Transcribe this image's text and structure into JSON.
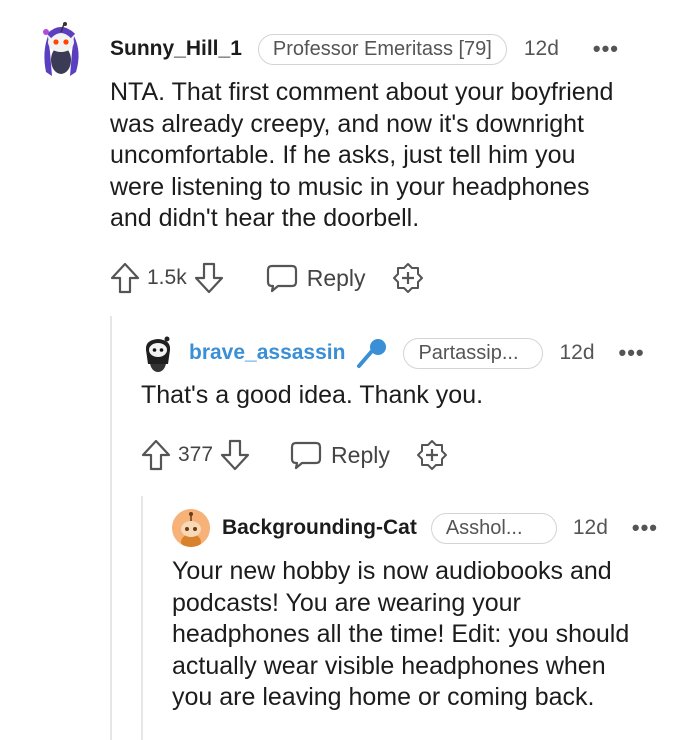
{
  "comments": [
    {
      "username": "Sunny_Hill_1",
      "flair": "Professor Emeritass [79]",
      "time": "12d",
      "more": "•••",
      "lines": [
        "NTA. That first comment about your boyfriend",
        "was already creepy, and now it's downright",
        "uncomfortable. If he asks, just tell him you",
        "were listening to music in your headphones",
        "and didn't hear the doorbell."
      ],
      "score": "1.5k",
      "reply_label": "Reply",
      "avatar_icon": "snoo-avatar-purple-hair"
    },
    {
      "username": "brave_assassin",
      "flair": "Partassip...",
      "time": "12d",
      "more": "•••",
      "lines": [
        "That's a good idea. Thank you."
      ],
      "score": "377",
      "reply_label": "Reply",
      "avatar_icon": "snoo-avatar-dark-hair",
      "badge_icon": "microphone-icon"
    },
    {
      "username": "Backgrounding-Cat",
      "flair": "Asshol...",
      "time": "12d",
      "more": "•••",
      "lines": [
        "Your new hobby is now audiobooks and",
        "podcasts! You are wearing your",
        "headphones all the time! Edit: you should",
        "actually wear visible headphones when",
        "you are leaving home or coming back."
      ],
      "avatar_icon": "snoo-avatar-orange"
    }
  ],
  "colors": {
    "op_username": "#3a8fd6",
    "thread_line": "#e6e6e6",
    "text": "#1c1c1c",
    "muted": "#555555"
  }
}
